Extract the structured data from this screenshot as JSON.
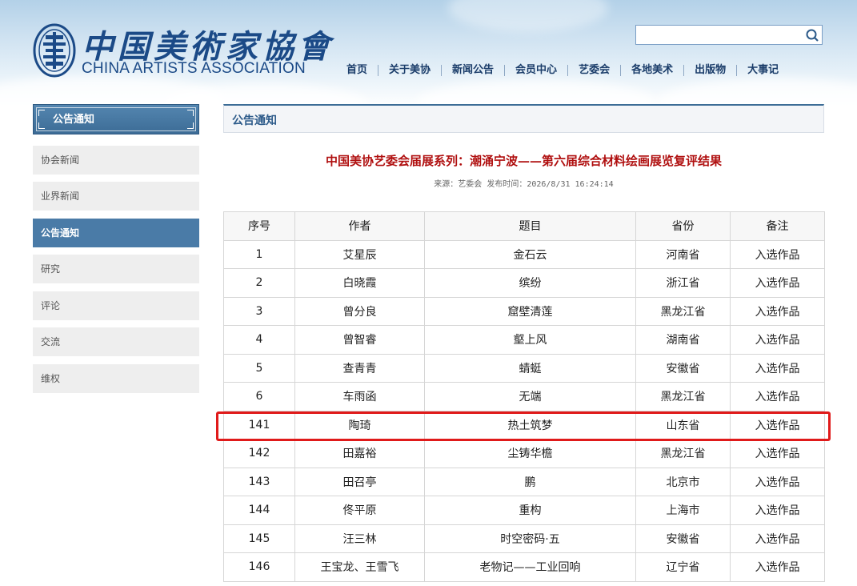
{
  "header": {
    "logo_cn": "中国美術家協會",
    "logo_en": "CHINA ARTISTS ASSOCIATION",
    "search": {
      "placeholder": "",
      "value": ""
    },
    "nav": [
      "首页",
      "关于美协",
      "新闻公告",
      "会员中心",
      "艺委会",
      "各地美术",
      "出版物",
      "大事记"
    ]
  },
  "sidebar": {
    "title": "公告通知",
    "items": [
      {
        "label": "协会新闻",
        "active": false
      },
      {
        "label": "业界新闻",
        "active": false
      },
      {
        "label": "公告通知",
        "active": true
      },
      {
        "label": "研究",
        "active": false
      },
      {
        "label": "评论",
        "active": false
      },
      {
        "label": "交流",
        "active": false
      },
      {
        "label": "维权",
        "active": false
      }
    ]
  },
  "main": {
    "header": "公告通知",
    "article": {
      "title": "中国美协艺委会届展系列：潮涌宁波——第六届综合材料绘画展览复评结果",
      "meta": "来源：艺委会 发布时间：2026/8/31 16:24:14"
    },
    "table": {
      "columns": [
        "序号",
        "作者",
        "题目",
        "省份",
        "备注"
      ],
      "rows": [
        [
          "1",
          "艾星辰",
          "金石云",
          "河南省",
          "入选作品"
        ],
        [
          "2",
          "白晓霞",
          "缤纷",
          "浙江省",
          "入选作品"
        ],
        [
          "3",
          "曾分良",
          "窟壁清莲",
          "黑龙江省",
          "入选作品"
        ],
        [
          "4",
          "曾智睿",
          "壑上风",
          "湖南省",
          "入选作品"
        ],
        [
          "5",
          "查青青",
          "蜻蜓",
          "安徽省",
          "入选作品"
        ],
        [
          "6",
          "车雨函",
          "无端",
          "黑龙江省",
          "入选作品"
        ],
        [
          "141",
          "陶琦",
          "热土筑梦",
          "山东省",
          "入选作品"
        ],
        [
          "142",
          "田嘉裕",
          "尘铸华檐",
          "黑龙江省",
          "入选作品"
        ],
        [
          "143",
          "田召亭",
          "鹏",
          "北京市",
          "入选作品"
        ],
        [
          "144",
          "佟平原",
          "重构",
          "上海市",
          "入选作品"
        ],
        [
          "145",
          "汪三林",
          "时空密码·五",
          "安徽省",
          "入选作品"
        ],
        [
          "146",
          "王宝龙、王雪飞",
          "老物记——工业回响",
          "辽宁省",
          "入选作品"
        ]
      ],
      "highlighted_row": 6
    }
  },
  "colors": {
    "brand": "#1b4a87",
    "sidebar_active": "#4a7ba7",
    "title_red": "#b01010",
    "highlight": "#e01a1a"
  }
}
